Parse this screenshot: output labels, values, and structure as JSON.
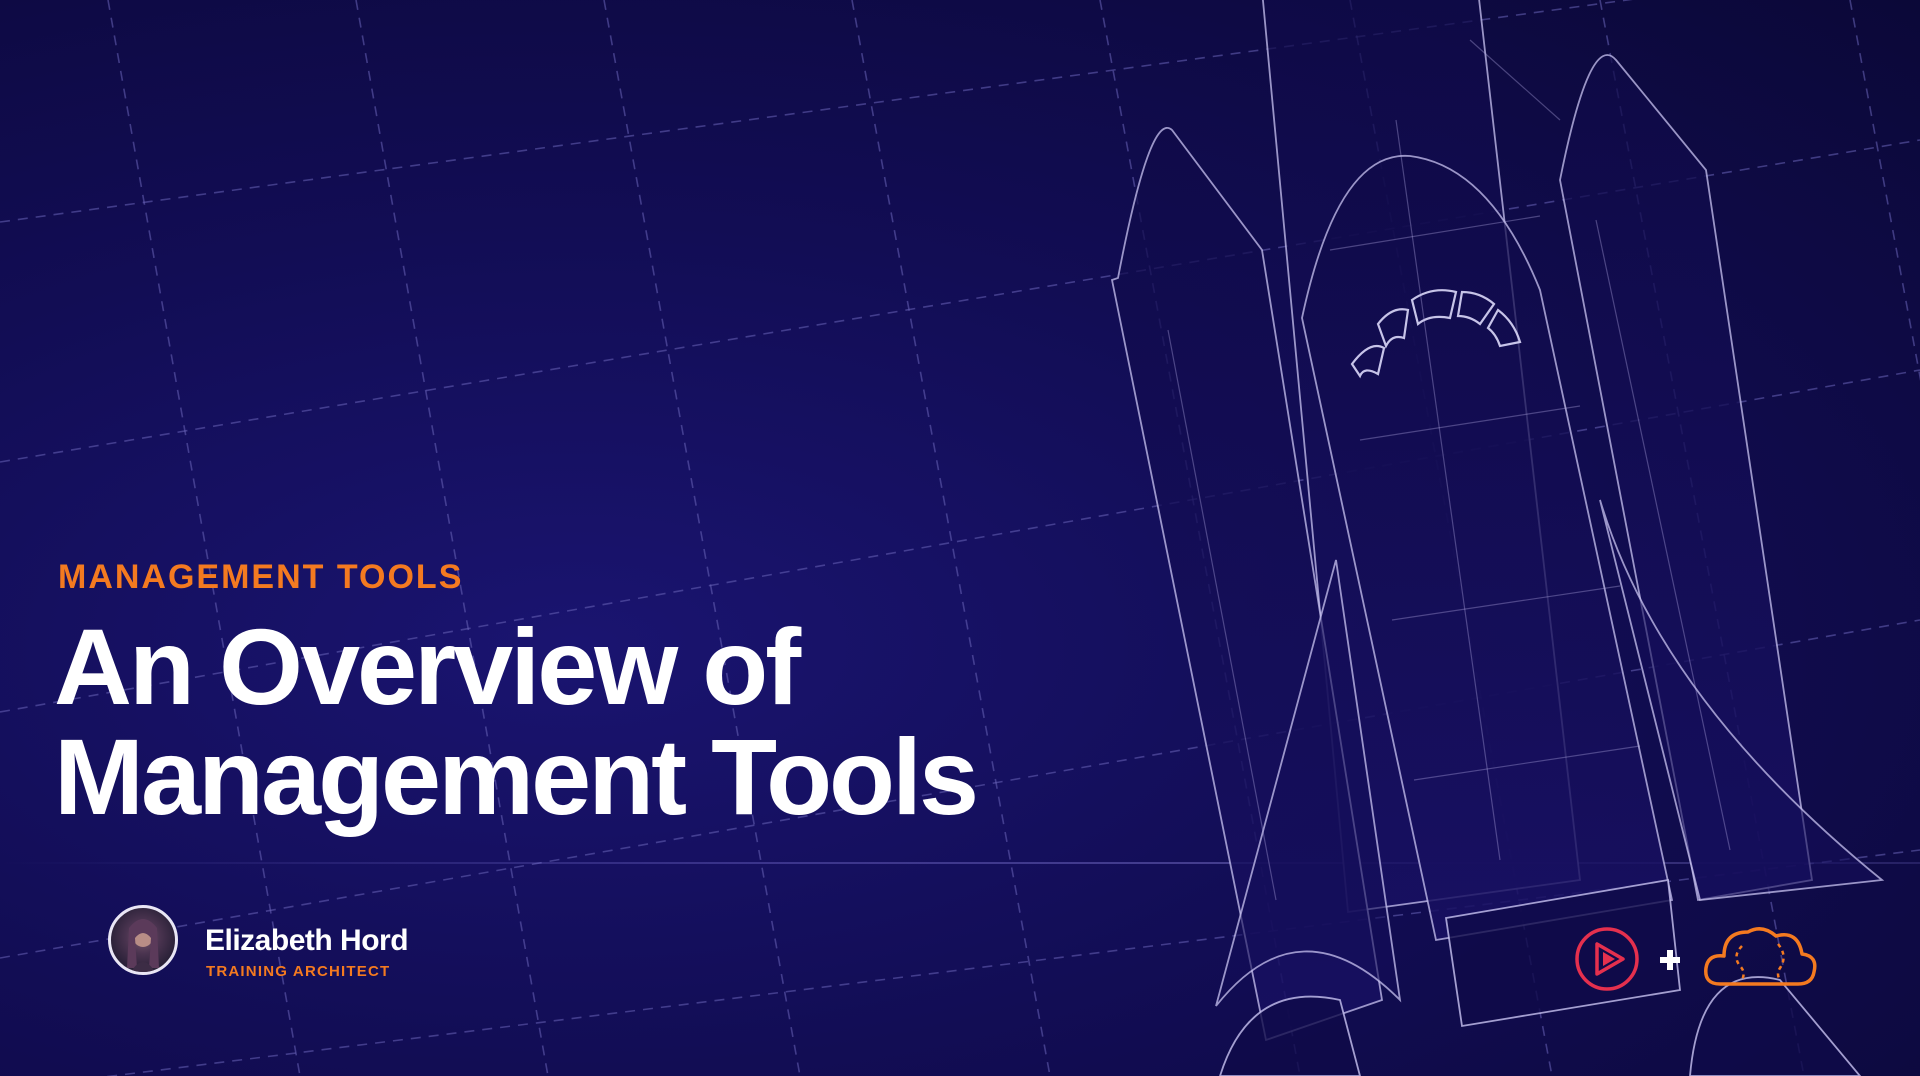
{
  "slide": {
    "eyebrow": "MANAGEMENT TOOLS",
    "title_line_1": "An Overview of",
    "title_line_2": "Management Tools"
  },
  "presenter": {
    "name": "Elizabeth Hord",
    "role": "TRAINING ARCHITECT"
  },
  "branding": {
    "plus_sign": "+",
    "icons": [
      "pluralsight-play-icon",
      "acloudguru-cloud-icon"
    ]
  },
  "colors": {
    "background": "#120d55",
    "accent_orange": "#f47a20",
    "title_text": "#ffffff",
    "logo_red": "#e5304e",
    "grid_line": "#5a55a8"
  }
}
